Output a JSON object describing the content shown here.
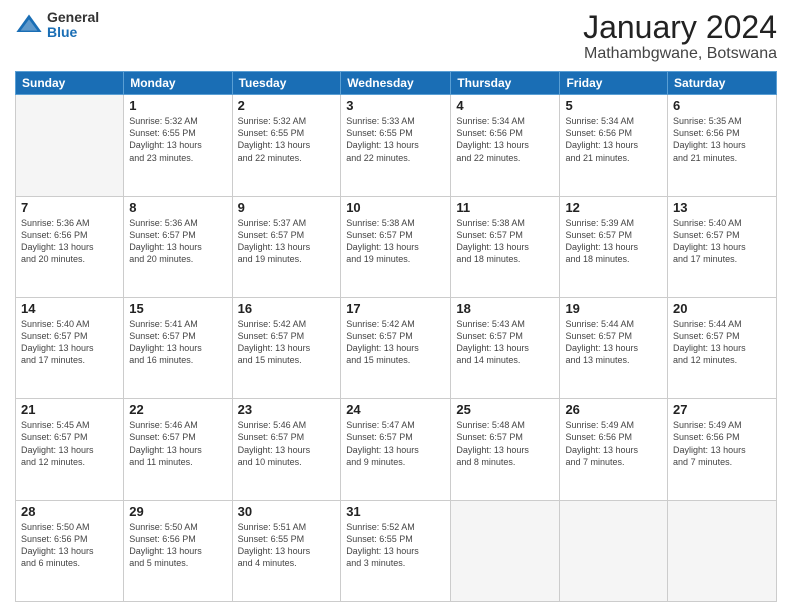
{
  "logo": {
    "general": "General",
    "blue": "Blue"
  },
  "header": {
    "month": "January 2024",
    "location": "Mathambgwane, Botswana"
  },
  "weekdays": [
    "Sunday",
    "Monday",
    "Tuesday",
    "Wednesday",
    "Thursday",
    "Friday",
    "Saturday"
  ],
  "weeks": [
    [
      {
        "day": "",
        "info": ""
      },
      {
        "day": "1",
        "info": "Sunrise: 5:32 AM\nSunset: 6:55 PM\nDaylight: 13 hours\nand 23 minutes."
      },
      {
        "day": "2",
        "info": "Sunrise: 5:32 AM\nSunset: 6:55 PM\nDaylight: 13 hours\nand 22 minutes."
      },
      {
        "day": "3",
        "info": "Sunrise: 5:33 AM\nSunset: 6:55 PM\nDaylight: 13 hours\nand 22 minutes."
      },
      {
        "day": "4",
        "info": "Sunrise: 5:34 AM\nSunset: 6:56 PM\nDaylight: 13 hours\nand 22 minutes."
      },
      {
        "day": "5",
        "info": "Sunrise: 5:34 AM\nSunset: 6:56 PM\nDaylight: 13 hours\nand 21 minutes."
      },
      {
        "day": "6",
        "info": "Sunrise: 5:35 AM\nSunset: 6:56 PM\nDaylight: 13 hours\nand 21 minutes."
      }
    ],
    [
      {
        "day": "7",
        "info": "Sunrise: 5:36 AM\nSunset: 6:56 PM\nDaylight: 13 hours\nand 20 minutes."
      },
      {
        "day": "8",
        "info": "Sunrise: 5:36 AM\nSunset: 6:57 PM\nDaylight: 13 hours\nand 20 minutes."
      },
      {
        "day": "9",
        "info": "Sunrise: 5:37 AM\nSunset: 6:57 PM\nDaylight: 13 hours\nand 19 minutes."
      },
      {
        "day": "10",
        "info": "Sunrise: 5:38 AM\nSunset: 6:57 PM\nDaylight: 13 hours\nand 19 minutes."
      },
      {
        "day": "11",
        "info": "Sunrise: 5:38 AM\nSunset: 6:57 PM\nDaylight: 13 hours\nand 18 minutes."
      },
      {
        "day": "12",
        "info": "Sunrise: 5:39 AM\nSunset: 6:57 PM\nDaylight: 13 hours\nand 18 minutes."
      },
      {
        "day": "13",
        "info": "Sunrise: 5:40 AM\nSunset: 6:57 PM\nDaylight: 13 hours\nand 17 minutes."
      }
    ],
    [
      {
        "day": "14",
        "info": "Sunrise: 5:40 AM\nSunset: 6:57 PM\nDaylight: 13 hours\nand 17 minutes."
      },
      {
        "day": "15",
        "info": "Sunrise: 5:41 AM\nSunset: 6:57 PM\nDaylight: 13 hours\nand 16 minutes."
      },
      {
        "day": "16",
        "info": "Sunrise: 5:42 AM\nSunset: 6:57 PM\nDaylight: 13 hours\nand 15 minutes."
      },
      {
        "day": "17",
        "info": "Sunrise: 5:42 AM\nSunset: 6:57 PM\nDaylight: 13 hours\nand 15 minutes."
      },
      {
        "day": "18",
        "info": "Sunrise: 5:43 AM\nSunset: 6:57 PM\nDaylight: 13 hours\nand 14 minutes."
      },
      {
        "day": "19",
        "info": "Sunrise: 5:44 AM\nSunset: 6:57 PM\nDaylight: 13 hours\nand 13 minutes."
      },
      {
        "day": "20",
        "info": "Sunrise: 5:44 AM\nSunset: 6:57 PM\nDaylight: 13 hours\nand 12 minutes."
      }
    ],
    [
      {
        "day": "21",
        "info": "Sunrise: 5:45 AM\nSunset: 6:57 PM\nDaylight: 13 hours\nand 12 minutes."
      },
      {
        "day": "22",
        "info": "Sunrise: 5:46 AM\nSunset: 6:57 PM\nDaylight: 13 hours\nand 11 minutes."
      },
      {
        "day": "23",
        "info": "Sunrise: 5:46 AM\nSunset: 6:57 PM\nDaylight: 13 hours\nand 10 minutes."
      },
      {
        "day": "24",
        "info": "Sunrise: 5:47 AM\nSunset: 6:57 PM\nDaylight: 13 hours\nand 9 minutes."
      },
      {
        "day": "25",
        "info": "Sunrise: 5:48 AM\nSunset: 6:57 PM\nDaylight: 13 hours\nand 8 minutes."
      },
      {
        "day": "26",
        "info": "Sunrise: 5:49 AM\nSunset: 6:56 PM\nDaylight: 13 hours\nand 7 minutes."
      },
      {
        "day": "27",
        "info": "Sunrise: 5:49 AM\nSunset: 6:56 PM\nDaylight: 13 hours\nand 7 minutes."
      }
    ],
    [
      {
        "day": "28",
        "info": "Sunrise: 5:50 AM\nSunset: 6:56 PM\nDaylight: 13 hours\nand 6 minutes."
      },
      {
        "day": "29",
        "info": "Sunrise: 5:50 AM\nSunset: 6:56 PM\nDaylight: 13 hours\nand 5 minutes."
      },
      {
        "day": "30",
        "info": "Sunrise: 5:51 AM\nSunset: 6:55 PM\nDaylight: 13 hours\nand 4 minutes."
      },
      {
        "day": "31",
        "info": "Sunrise: 5:52 AM\nSunset: 6:55 PM\nDaylight: 13 hours\nand 3 minutes."
      },
      {
        "day": "",
        "info": ""
      },
      {
        "day": "",
        "info": ""
      },
      {
        "day": "",
        "info": ""
      }
    ]
  ]
}
